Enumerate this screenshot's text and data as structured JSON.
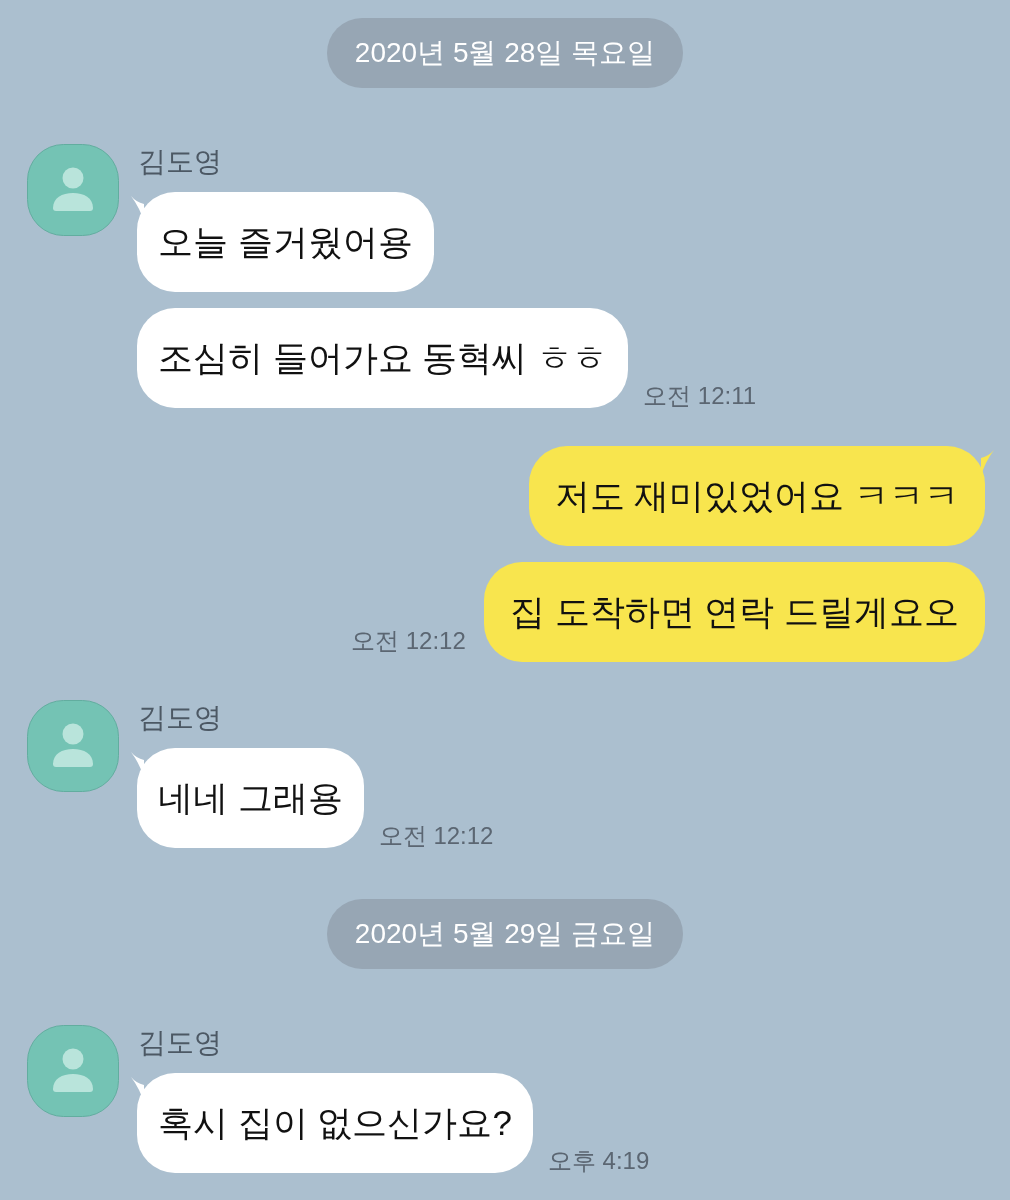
{
  "chat": [
    {
      "kind": "date",
      "text": "2020년 5월 28일 목요일"
    },
    {
      "kind": "received",
      "sender": "김도영",
      "messages": [
        {
          "text": "오늘 즐거웠어용"
        },
        {
          "text": "조심히 들어가요 동혁씨 ㅎㅎ"
        }
      ],
      "time": "오전 12:11"
    },
    {
      "kind": "sent",
      "messages": [
        {
          "text": "저도 재미있었어요 ㅋㅋㅋ"
        },
        {
          "text": "집 도착하면 연락 드릴게요오"
        }
      ],
      "time": "오전 12:12"
    },
    {
      "kind": "received",
      "sender": "김도영",
      "messages": [
        {
          "text": "네네 그래용"
        }
      ],
      "time": "오전 12:12"
    },
    {
      "kind": "date",
      "text": "2020년 5월 29일 금요일"
    },
    {
      "kind": "received",
      "sender": "김도영",
      "messages": [
        {
          "text": "혹시 집이 없으신가요?"
        }
      ],
      "time": "오후 4:19"
    }
  ]
}
